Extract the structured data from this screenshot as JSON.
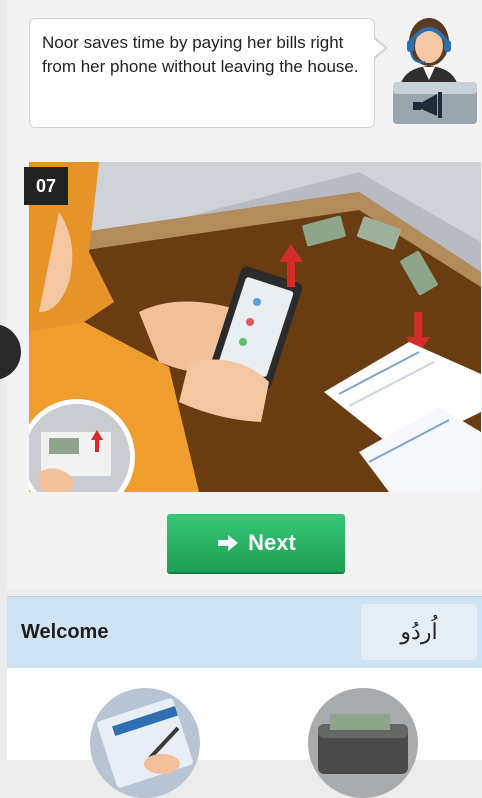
{
  "info_card": {
    "message": "Noor saves time by paying her bills right from her phone without leaving the house."
  },
  "step": {
    "number": "07",
    "image_description": "Woman paying bills on phone"
  },
  "actions": {
    "next_label": "Next"
  },
  "welcome": {
    "title": "Welcome",
    "language_button": "اُردُو"
  },
  "icons": {
    "next": "arrow-right-icon",
    "agent": "customer-support-agent-icon",
    "megaphone": "megaphone-icon"
  },
  "colors": {
    "next_button": "#2bb765",
    "welcome_bar": "#cfe3f2",
    "step_badge": "#222222"
  }
}
